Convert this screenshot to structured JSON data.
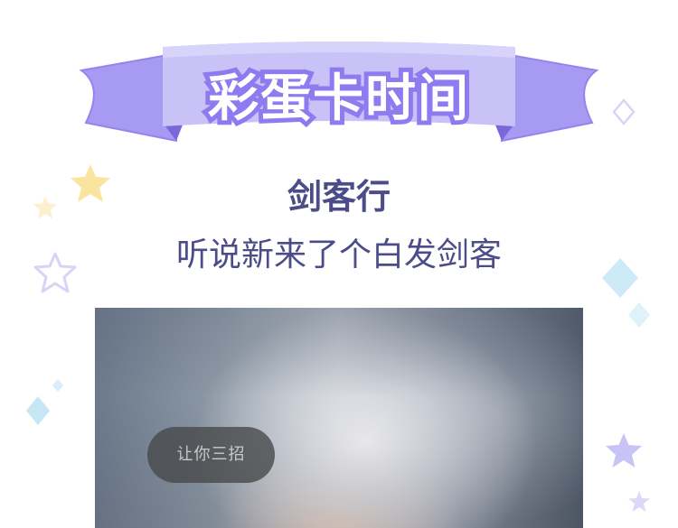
{
  "banner": {
    "title": "彩蛋卡时间"
  },
  "work": {
    "title": "剑客行",
    "subtitle": "听说新来了个白发剑客"
  },
  "image_card": {
    "button_label": "让你三招"
  },
  "colors": {
    "banner_main": "#c9c2f7",
    "banner_dark": "#8f7af0",
    "title_text": "#4b4c88",
    "star_yellow": "#fbe3a0",
    "star_purple": "#c7c3f5",
    "diamond_blue": "#bfe3f3"
  },
  "icons": {
    "stars": [
      "star-icon",
      "star-outline-icon"
    ],
    "diamonds": [
      "diamond-icon",
      "diamond-outline-icon"
    ]
  }
}
